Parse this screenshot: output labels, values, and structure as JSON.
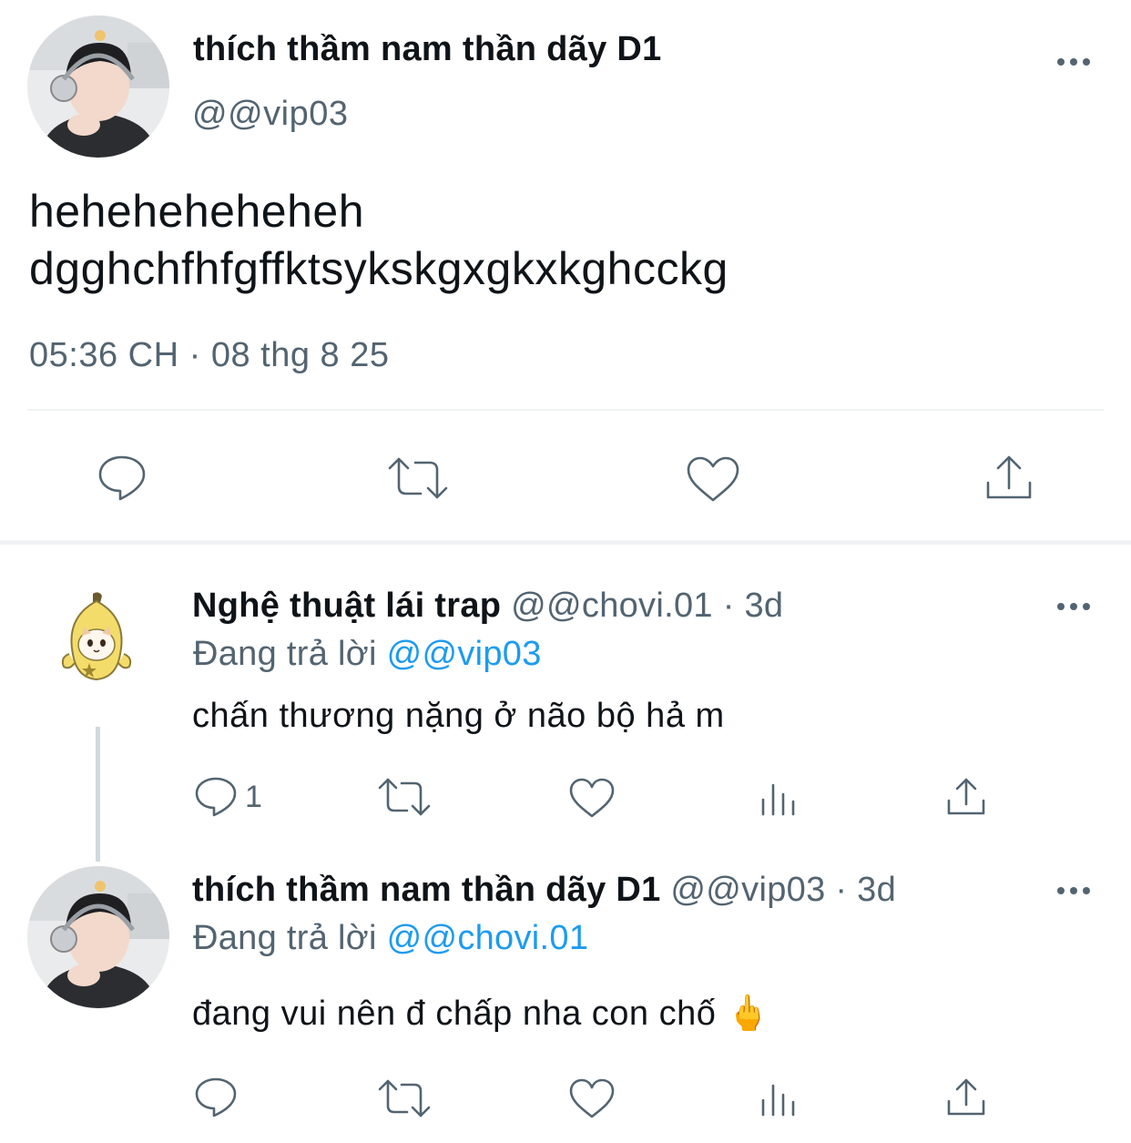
{
  "main_tweet": {
    "display_name": "thích thầm nam thần dãy D1",
    "handle": "@@vip03",
    "text_line1": "heheheheheheh",
    "text_line2": "dgghchfhfgffktsykskgxgkxkghcckg",
    "time": "05:36 CH",
    "separator": "·",
    "date": "08 thg 8 25",
    "actions": [
      "reply-icon",
      "retweet-icon",
      "like-icon",
      "share-icon"
    ]
  },
  "replies": [
    {
      "display_name": "Nghệ thuật lái trap",
      "handle": "@@chovi.01",
      "age": "· 3d",
      "replying_prefix": "Đang trả lời",
      "replying_to": "@@vip03",
      "text": "chấn thương nặng ở não bộ hả m",
      "reply_count": "1",
      "actions": [
        "reply-icon",
        "retweet-icon",
        "like-icon",
        "views-icon",
        "share-icon"
      ]
    },
    {
      "display_name": "thích thầm nam thần dãy D1",
      "handle": "@@vip03",
      "age": "· 3d",
      "replying_prefix": "Đang trả lời",
      "replying_to": "@@chovi.01",
      "text": "đang vui nên đ chấp nha con chố",
      "emoji": "🖕",
      "reply_count": "",
      "actions": [
        "reply-icon",
        "retweet-icon",
        "like-icon",
        "views-icon",
        "share-icon"
      ]
    }
  ],
  "colors": {
    "text": "#0f1419",
    "secondary": "#536471",
    "link": "#1d9bf0",
    "divider": "#eff3f4"
  }
}
